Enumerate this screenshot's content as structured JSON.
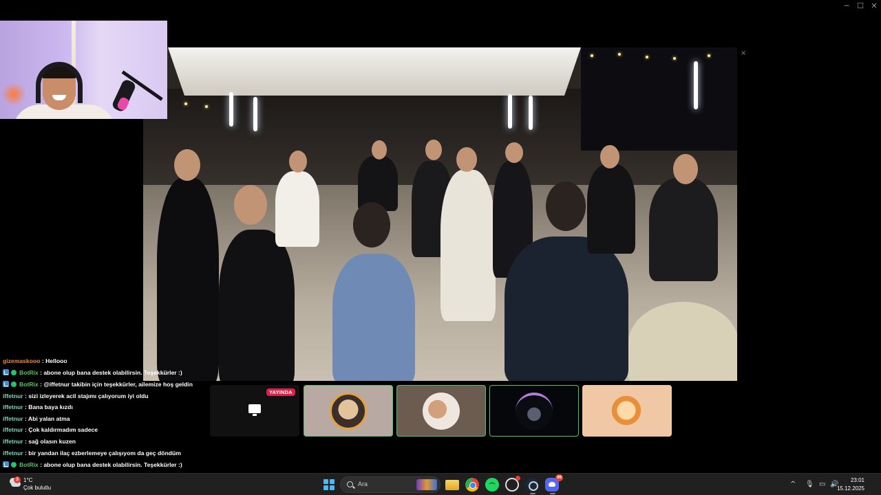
{
  "window": {
    "minimize_label": "─",
    "maximize_label": "☐",
    "close_label": "✕",
    "video_close_label": "×"
  },
  "chat": {
    "messages": [
      {
        "user": "gizemaskooo",
        "text": ": Hellooo",
        "user_color": "#f08a3c",
        "badges": false
      },
      {
        "user": "BotRix",
        "text": ": abone olup bana destek olabilirsin. Teşekkürler :)",
        "user_color": "#53c65d",
        "badges": true
      },
      {
        "user": "BotRix",
        "text": ": @iffetnur takibin için teşekkürler, ailemize hoş geldin",
        "user_color": "#53c65d",
        "badges": true
      },
      {
        "user": "iffetnur",
        "text": ": sizi izleyerek acil stajımı çalıyorum iyi oldu",
        "user_color": "#7bd9b4",
        "badges": false
      },
      {
        "user": "iffetnur",
        "text": ": Bana baya kızdı",
        "user_color": "#7bd9b4",
        "badges": false
      },
      {
        "user": "iffetnur",
        "text": ": Abi yalan atma",
        "user_color": "#7bd9b4",
        "badges": false
      },
      {
        "user": "iffetnur",
        "text": ": Çok kaldırmadım sadece",
        "user_color": "#7bd9b4",
        "badges": false
      },
      {
        "user": "iffetnur",
        "text": ": sağ olasın kuzen",
        "user_color": "#7bd9b4",
        "badges": false
      },
      {
        "user": "iffetnur",
        "text": ": bir yandan ilaç ezberlemeye çalışıyom da geç döndüm",
        "user_color": "#7bd9b4",
        "badges": false
      },
      {
        "user": "BotRix",
        "text": ": abone olup bana destek olabilirsin. Teşekkürler :)",
        "user_color": "#53c65d",
        "badges": true
      }
    ]
  },
  "participants": {
    "live_badge": "YAYINDA",
    "live_icon": "screen-share-icon",
    "accent_border": "#4cc46a"
  },
  "taskbar": {
    "weather": {
      "badge": "3",
      "temp": "1°C",
      "condition": "Çok bulutlu"
    },
    "search_placeholder": "Ara",
    "discord_badge": "99",
    "clock": {
      "time": "23:01",
      "date": "15.12.2025"
    },
    "tray": {
      "chevron": "^",
      "mic": "🎙",
      "display": "▭",
      "volume": "🔊"
    }
  }
}
